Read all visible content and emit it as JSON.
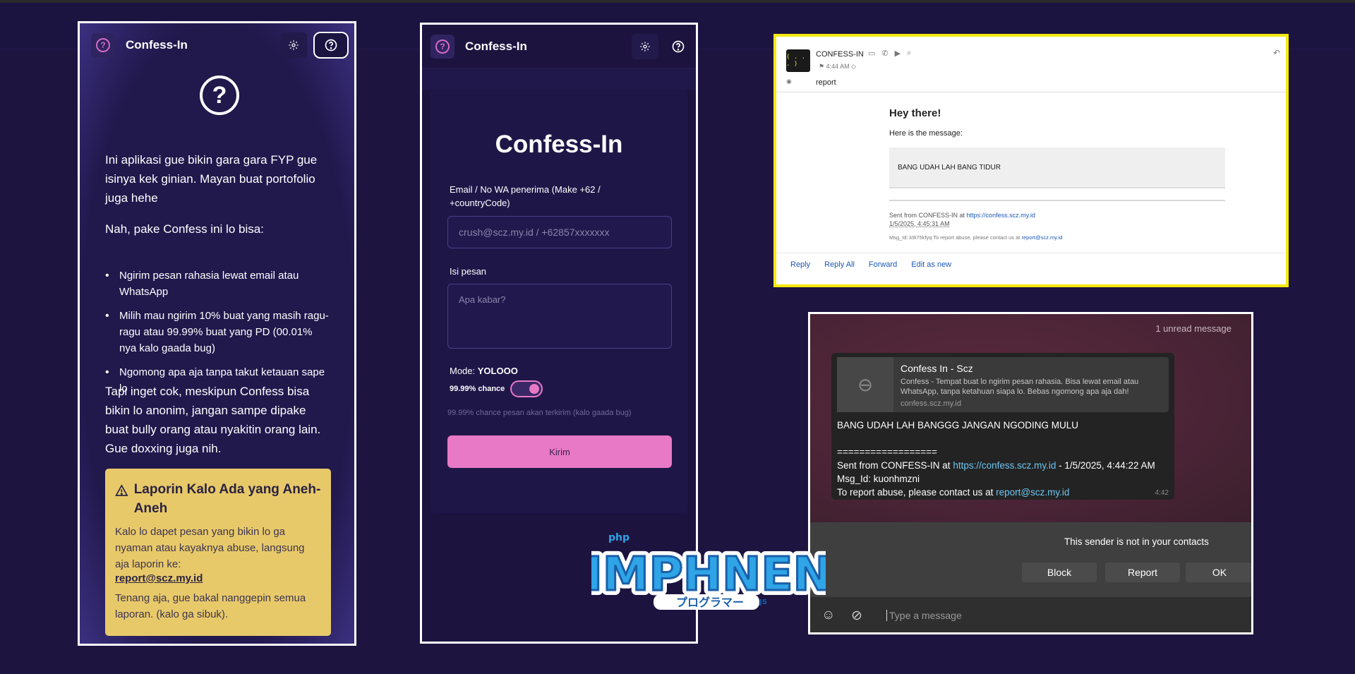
{
  "app": {
    "name": "Confess-In"
  },
  "about": {
    "intro": "Ini aplikasi gue bikin gara gara FYP gue isinya kek ginian. Mayan buat portofolio juga hehe",
    "lead": "Nah, pake Confess ini lo bisa:",
    "features": [
      "Ngirim pesan rahasia lewat email atau WhatsApp",
      "Milih mau ngirim 10% buat yang masih ragu-ragu atau 99.99% buat yang PD (00.01% nya kalo gaada bug)",
      "Ngomong apa aja tanpa takut ketauan sape lo"
    ],
    "warning_text": "Tapi inget cok, meskipun Confess bisa bikin lo anonim, jangan sampe dipake buat bully orang atau nyakitin orang lain. Gue doxxing juga nih.",
    "report": {
      "title": "Laporin Kalo Ada yang Aneh-Aneh",
      "body": "Kalo lo dapet pesan yang bikin lo ga nyaman atau kayaknya abuse, langsung aja laporin ke:",
      "email": "report@scz.my.id",
      "footer": "Tenang aja, gue bakal nanggepin semua laporan. (kalo ga sibuk)."
    }
  },
  "form": {
    "title": "Confess-In",
    "recipient_label": "Email / No WA penerima (Make +62 / +countryCode)",
    "recipient_placeholder": "crush@scz.my.id / +62857xxxxxxx",
    "message_label": "Isi pesan",
    "message_placeholder": "Apa kabar?",
    "mode_label": "Mode:",
    "mode_value": "YOLOOO",
    "chance_label": "99.99% chance",
    "hint": "99.99% chance pesan akan terkirim (kalo gaada bug)",
    "send_label": "Kirim",
    "toggle_on": true
  },
  "email": {
    "avatar": "( . . . )",
    "sender": "CONFESS-IN",
    "time": "4:44 AM",
    "subject": "report",
    "greeting": "Hey there!",
    "intro": "Here is the message:",
    "message": "BANG UDAH LAH BANG TIDUR",
    "sent_from": "Sent from CONFESS-IN at",
    "sent_url": "https://confess.scz.my.id",
    "sent_date": "1/5/2025, 4:45:31 AM",
    "msg_id": "Msg_Id: k9i75kfyq To report abuse, please contact us at",
    "abuse_email": "report@scz.my.id",
    "actions": [
      "Reply",
      "Reply All",
      "Forward",
      "Edit as new"
    ]
  },
  "whatsapp": {
    "unread": "1 unread message",
    "preview_title": "Confess In - Scz",
    "preview_desc": "Confess - Tempat buat lo ngirim pesan rahasia. Bisa lewat email atau WhatsApp, tanpa ketahuan siapa lo. Bebas ngomong apa aja dah!",
    "preview_url": "confess.scz.my.id",
    "line1": "BANG UDAH LAH BANGGG JANGAN NGODING MULU",
    "divider": "==================",
    "sent_prefix": "Sent from CONFESS-IN at",
    "sent_url": "https://confess.scz.my.id",
    "sent_suffix": "- 1/5/2025, 4:44:22 AM",
    "msg_id": "Msg_Id: kuonhmzni",
    "abuse_prefix": "To report abuse, please contact us at",
    "abuse_email": "report@scz.my.id",
    "time": "4:42",
    "not_contact": "This sender is not in your contacts",
    "block": "Block",
    "report": "Report",
    "ok": "OK",
    "input_placeholder": "Type a message"
  },
  "sticker": {
    "main": "IMPHNEN",
    "php": "php",
    "js": "JS",
    "sub": "プログラマー"
  },
  "colors": {
    "accent_pink": "#e879c6",
    "warning_yellow": "#e8c96a",
    "background": "#1d1440"
  }
}
